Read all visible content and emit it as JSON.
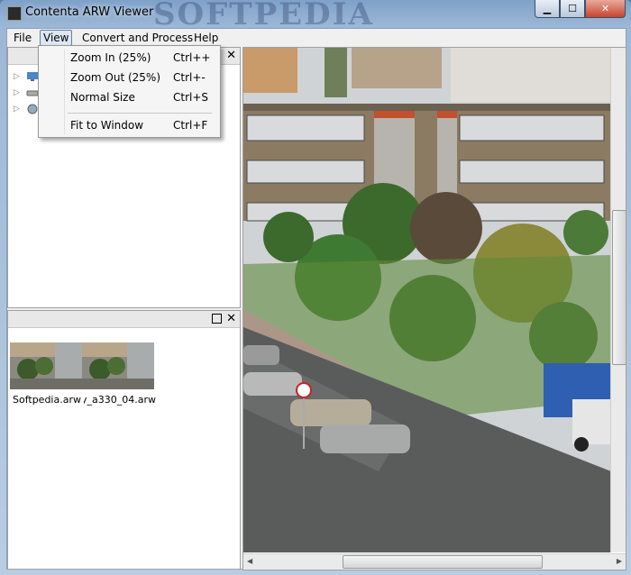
{
  "window": {
    "title": "Contenta ARW Viewer",
    "watermark": "SOFTPEDIA",
    "minimize_glyph": "▁",
    "maximize_glyph": "☐",
    "close_glyph": "✕"
  },
  "menubar": {
    "file": "File",
    "view": "View",
    "convert": "Convert and Process",
    "help": "Help"
  },
  "view_menu": {
    "items": [
      {
        "label": "Zoom In (25%)",
        "shortcut": "Ctrl++"
      },
      {
        "label": "Zoom Out (25%)",
        "shortcut": "Ctrl+-"
      },
      {
        "label": "Normal Size",
        "shortcut": "Ctrl+S"
      },
      {
        "label": "Fit to Window",
        "shortcut": "Ctrl+F"
      }
    ]
  },
  "folders_pane": {
    "close_glyph": "✕",
    "tree": [
      {
        "expander": "▷",
        "icon": "desktop-icon"
      },
      {
        "expander": "▷",
        "icon": "drive-icon"
      },
      {
        "expander": "▷",
        "icon": "network-icon"
      }
    ]
  },
  "thumbs_pane": {
    "close_glyph": "✕",
    "files": [
      {
        "name": "Softpedia.arw"
      },
      {
        "name": "ony_a330_04.arw"
      }
    ]
  },
  "colors": {
    "titlebar": "#8fb0d4",
    "close_button": "#c7452d",
    "menu_highlight": "#dde7f3"
  }
}
